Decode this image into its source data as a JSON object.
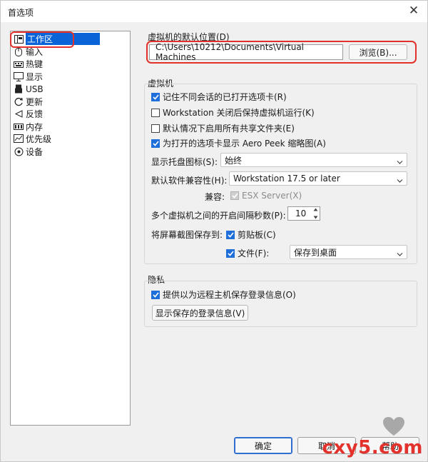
{
  "window": {
    "title": "首选项"
  },
  "nav": {
    "items": [
      {
        "label": "工作区",
        "icon": "workspace-icon",
        "selected": true
      },
      {
        "label": "输入",
        "icon": "mouse-icon"
      },
      {
        "label": "热键",
        "icon": "keyboard-icon"
      },
      {
        "label": "显示",
        "icon": "monitor-icon"
      },
      {
        "label": "USB",
        "icon": "usb-icon"
      },
      {
        "label": "更新",
        "icon": "refresh-icon"
      },
      {
        "label": "反馈",
        "icon": "feedback-icon"
      },
      {
        "label": "内存",
        "icon": "memory-icon"
      },
      {
        "label": "优先级",
        "icon": "priority-icon"
      },
      {
        "label": "设备",
        "icon": "device-icon"
      }
    ]
  },
  "default_location": {
    "label": "虚拟机的默认位置(D)",
    "path": "C:\\Users\\10212\\Documents\\Virtual Machines",
    "browse_label": "浏览(B)..."
  },
  "vm": {
    "group_label": "虚拟机",
    "remember_tabs": {
      "label": "记住不同会话的已打开选项卡(R)",
      "checked": true
    },
    "keep_running": {
      "label": "Workstation 关闭后保持虚拟机运行(K)",
      "checked": false
    },
    "enable_shared": {
      "label": "默认情况下启用所有共享文件夹(E)",
      "checked": false
    },
    "aero_peek": {
      "label": "为打开的选项卡显示 Aero Peek 缩略图(A)",
      "checked": true
    },
    "tray_icon": {
      "label": "显示托盘图标(S):",
      "value": "始终"
    },
    "compat": {
      "label": "默认软件兼容性(H):",
      "value": "Workstation 17.5 or later"
    },
    "compat_with": {
      "label": "兼容:",
      "option": "ESX Server(X)"
    },
    "interval": {
      "label": "多个虚拟机之间的开启间隔秒数(P):",
      "value": "10"
    },
    "save_screenshot": {
      "label": "将屏幕截图保存到:"
    },
    "clipboard": {
      "label": "剪贴板(C)",
      "checked": true
    },
    "file": {
      "label": "文件(F):",
      "checked": true,
      "value": "保存到桌面"
    }
  },
  "privacy": {
    "group_label": "隐私",
    "save_login": {
      "label": "提供以为远程主机保存登录信息(O)",
      "checked": true
    },
    "show_saved_label": "显示保存的登录信息(V)"
  },
  "buttons": {
    "ok": "确定",
    "cancel": "取消",
    "help": "帮助"
  },
  "watermark": "cxy5.com",
  "colors": {
    "accent": "#1e6fd9",
    "highlight": "#e0322a",
    "selection": "#0a64d8"
  }
}
